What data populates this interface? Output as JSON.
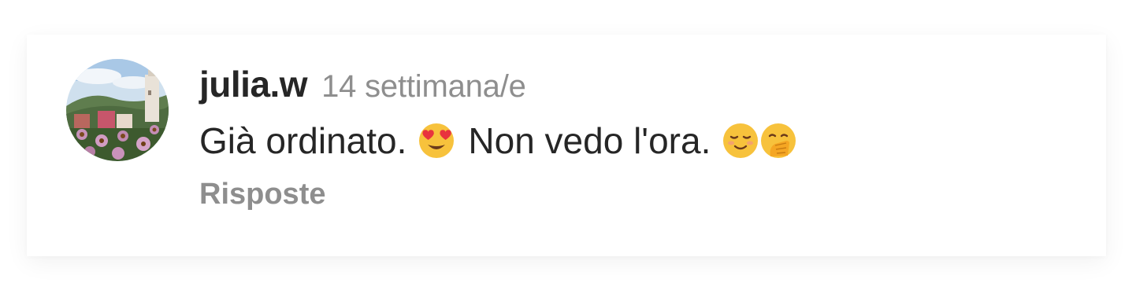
{
  "comment": {
    "username": "julia.w",
    "timestamp": "14 settimana/e",
    "text_part1": "Già ordinato.",
    "text_part2": "Non vedo l'ora.",
    "emojis": [
      "heart-eyes-emoji",
      "smiling-face-emoji",
      "hand-over-mouth-emoji"
    ],
    "replies_label": "Risposte"
  },
  "colors": {
    "text_primary": "#262626",
    "text_secondary": "#8e8e8e",
    "emoji_yellow": "#f7c23c",
    "heart_red": "#e8343e"
  }
}
